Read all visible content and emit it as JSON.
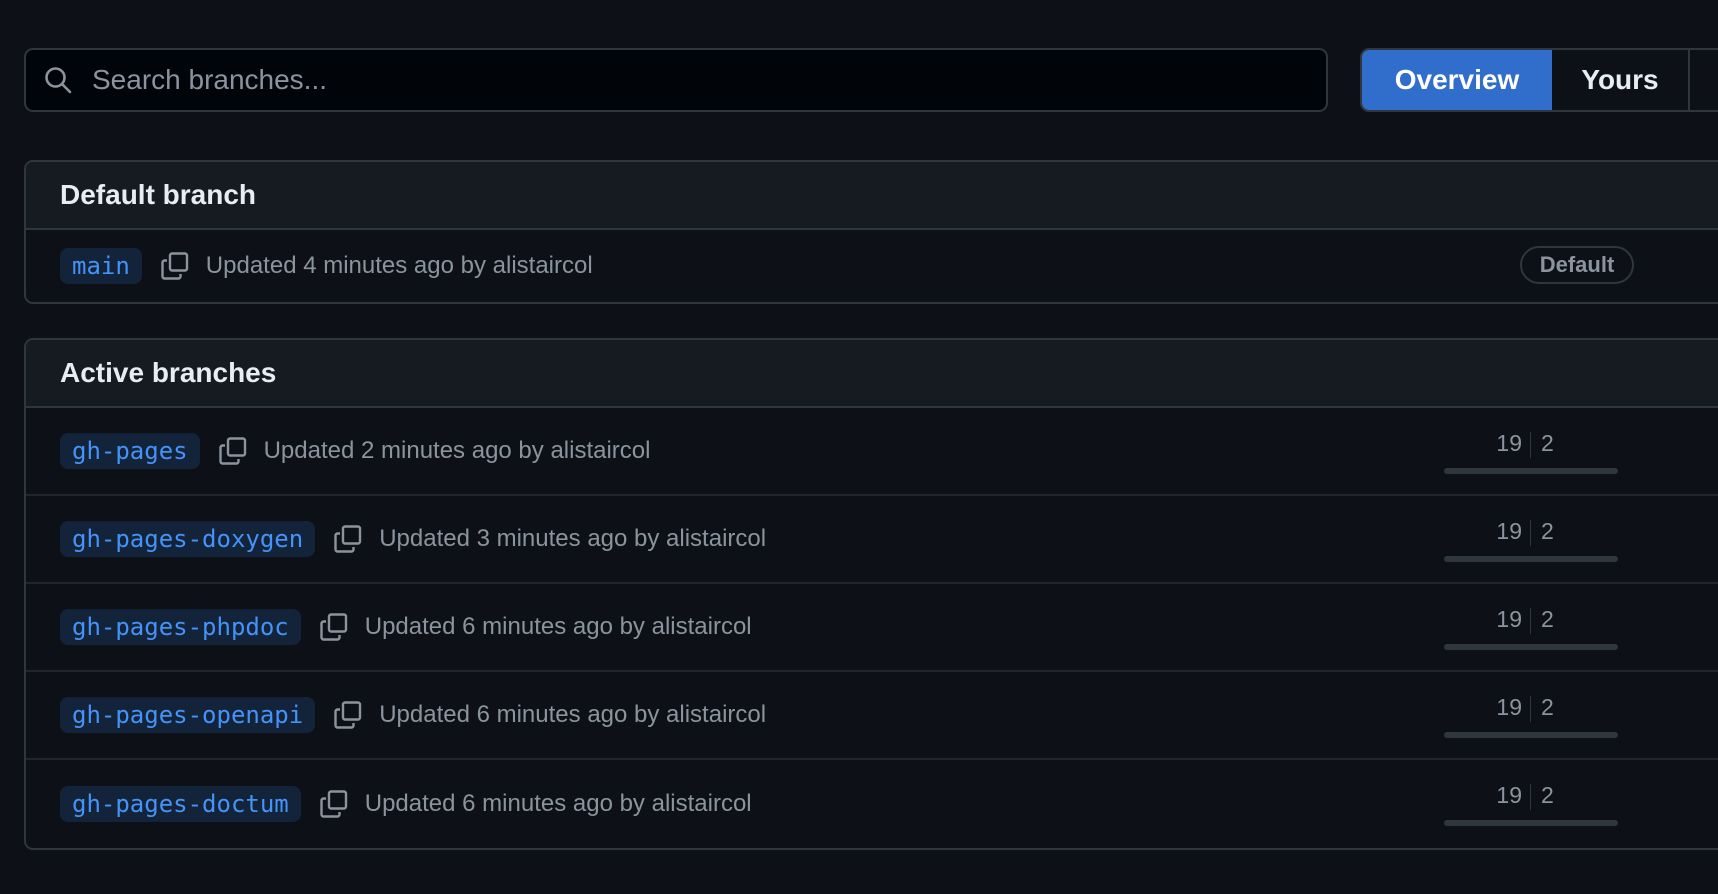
{
  "search": {
    "placeholder": "Search branches..."
  },
  "tabs": [
    {
      "label": "Overview",
      "active": true
    },
    {
      "label": "Yours",
      "active": false
    }
  ],
  "default_section": {
    "title": "Default branch",
    "branch": {
      "name": "main",
      "updated": "Updated 4 minutes ago by alistaircol",
      "badge": "Default"
    }
  },
  "active_section": {
    "title": "Active branches",
    "branches": [
      {
        "name": "gh-pages",
        "updated": "Updated 2 minutes ago by alistaircol",
        "behind": "19",
        "ahead": "2"
      },
      {
        "name": "gh-pages-doxygen",
        "updated": "Updated 3 minutes ago by alistaircol",
        "behind": "19",
        "ahead": "2"
      },
      {
        "name": "gh-pages-phpdoc",
        "updated": "Updated 6 minutes ago by alistaircol",
        "behind": "19",
        "ahead": "2"
      },
      {
        "name": "gh-pages-openapi",
        "updated": "Updated 6 minutes ago by alistaircol",
        "behind": "19",
        "ahead": "2"
      },
      {
        "name": "gh-pages-doctum",
        "updated": "Updated 6 minutes ago by alistaircol",
        "behind": "19",
        "ahead": "2"
      }
    ]
  },
  "colors": {
    "background": "#0d1117",
    "accent": "#316dca",
    "branch_text": "#4493f8",
    "muted_text": "#8b949e",
    "border": "#30363d"
  }
}
